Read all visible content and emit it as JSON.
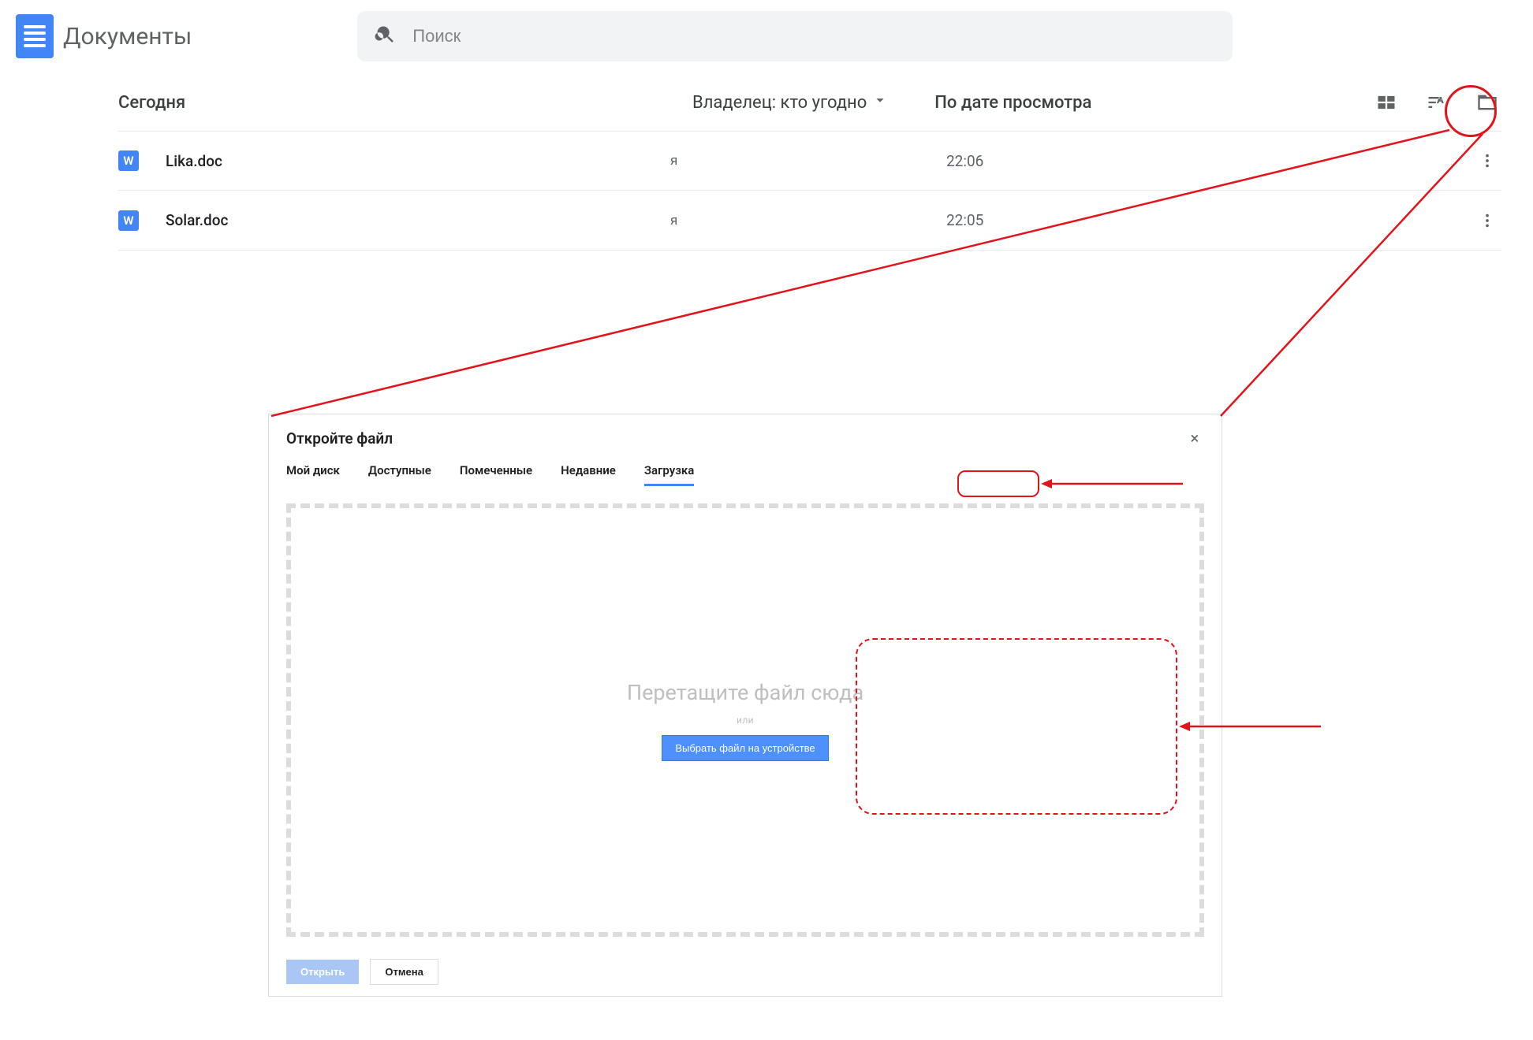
{
  "header": {
    "app_title": "Документы",
    "search_placeholder": "Поиск"
  },
  "toolbar": {
    "section": "Сегодня",
    "owner_filter": "Владелец: кто угодно",
    "sort_label": "По дате просмотра"
  },
  "files": [
    {
      "icon_letter": "W",
      "name": "Lika.doc",
      "owner": "я",
      "time": "22:06"
    },
    {
      "icon_letter": "W",
      "name": "Solar.doc",
      "owner": "я",
      "time": "22:05"
    }
  ],
  "dialog": {
    "title": "Откройте файл",
    "tabs": {
      "my_drive": "Мой диск",
      "shared": "Доступные",
      "starred": "Помеченные",
      "recent": "Недавние",
      "upload": "Загрузка"
    },
    "drop_title": "Перетащите файл сюда",
    "drop_or": "или",
    "pick_button": "Выбрать файл на устройстве",
    "open_button": "Открыть",
    "cancel_button": "Отмена"
  }
}
